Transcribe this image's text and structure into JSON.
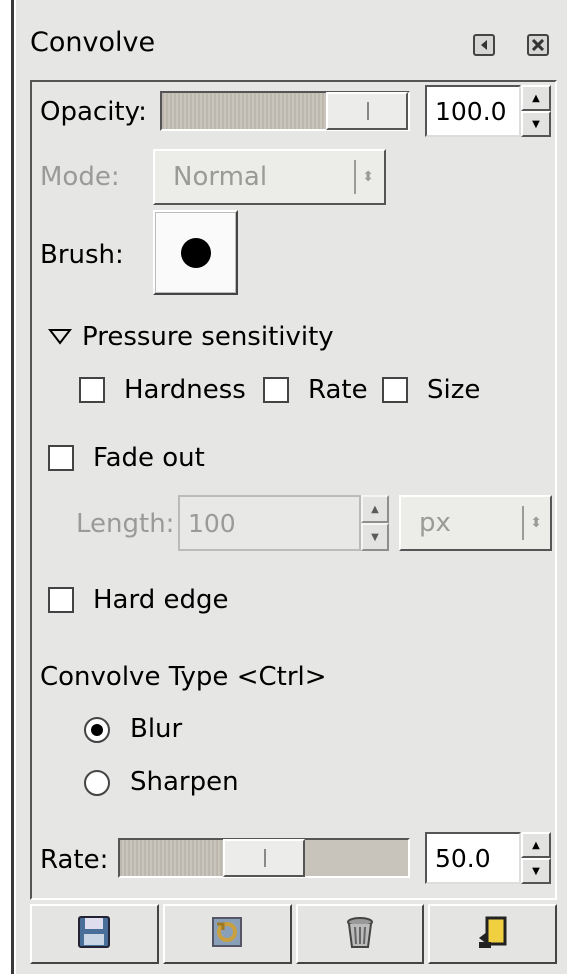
{
  "dock": {
    "title": "Convolve",
    "header_icons": [
      "menu-arrow-icon",
      "close-icon"
    ]
  },
  "opacity": {
    "label": "Opacity:",
    "value": "100.0",
    "level": 1.0
  },
  "mode": {
    "label": "Mode:",
    "value": "Normal"
  },
  "brush": {
    "label": "Brush:"
  },
  "pressure": {
    "label": "Pressure sensitivity",
    "expander_icon": "triangle-down-icon",
    "hardness": {
      "label": "Hardness",
      "checked": false
    },
    "rate": {
      "label": "Rate",
      "checked": false
    },
    "size": {
      "label": "Size",
      "checked": false
    }
  },
  "fade_out": {
    "label": "Fade out",
    "checked": false,
    "length_label": "Length:",
    "length_value": "100",
    "unit": "px"
  },
  "hard_edge": {
    "label": "Hard edge",
    "checked": false
  },
  "convolve_type": {
    "label": "Convolve Type  <Ctrl>",
    "options": [
      {
        "label": "Blur",
        "selected": true
      },
      {
        "label": "Sharpen",
        "selected": false
      }
    ]
  },
  "rate": {
    "label": "Rate:",
    "value": "50.0",
    "level": 0.5
  },
  "bottom_buttons": [
    "save-icon",
    "restore-icon",
    "delete-icon",
    "reset-icon"
  ]
}
